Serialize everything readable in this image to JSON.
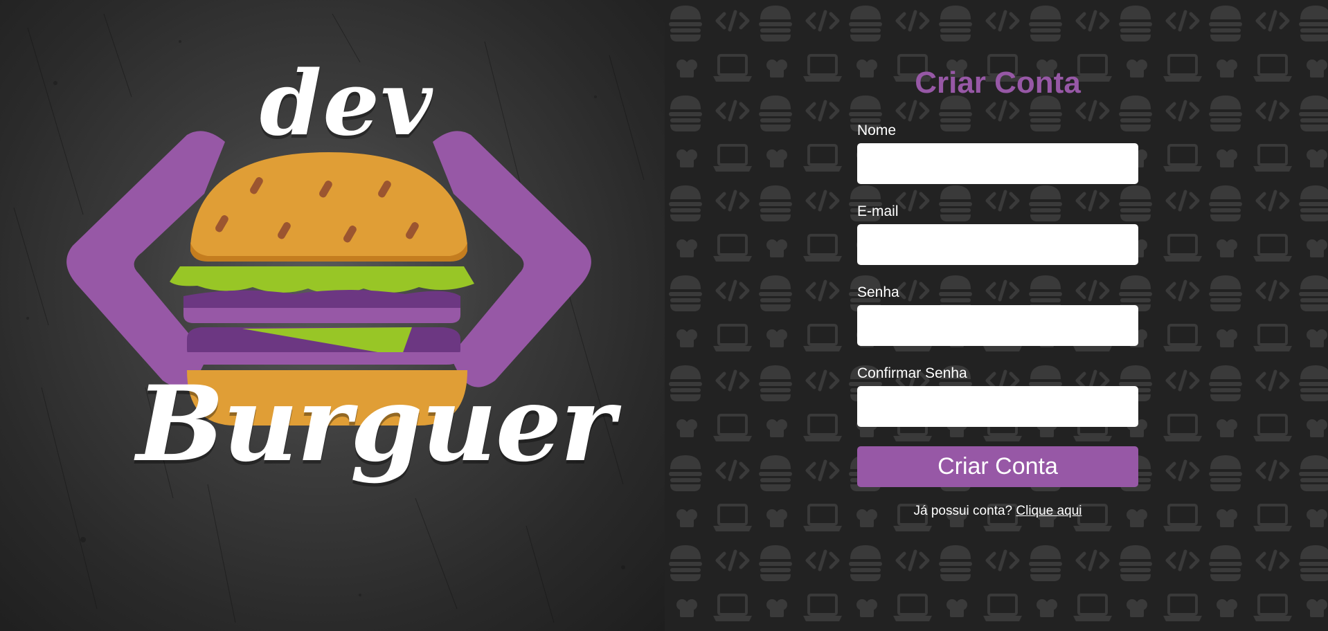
{
  "brand": {
    "logo_word_top": "dev",
    "logo_word_bottom": "Burguer"
  },
  "form": {
    "title": "Criar Conta",
    "fields": [
      {
        "label": "Nome",
        "value": "",
        "placeholder": ""
      },
      {
        "label": "E-mail",
        "value": "",
        "placeholder": ""
      },
      {
        "label": "Senha",
        "value": "",
        "placeholder": ""
      },
      {
        "label": "Confirmar Senha",
        "value": "",
        "placeholder": ""
      }
    ],
    "submit_label": "Criar Conta",
    "login_prompt": "Já possui conta?",
    "login_link": "Clique aqui"
  },
  "colors": {
    "accent": "#9758a6",
    "bun": "#e09e36",
    "lettuce": "#98c626",
    "patty": "#6c3782",
    "background_left": "#333333",
    "background_right": "#222222"
  },
  "icons": [
    "burger-icon",
    "laptop-icon",
    "code-icon",
    "chef-hat-icon"
  ]
}
